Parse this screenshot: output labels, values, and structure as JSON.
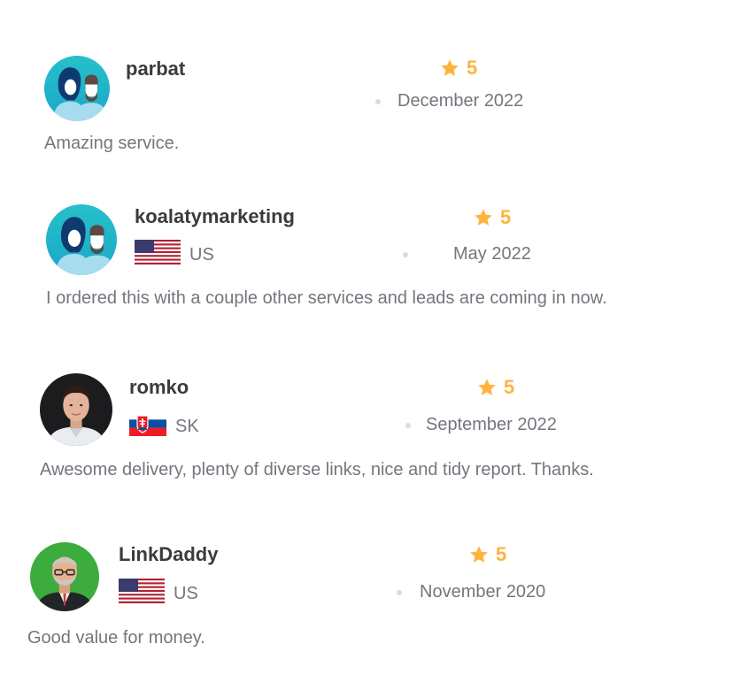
{
  "accent_colors": {
    "star": "#ffb33e",
    "username": "#3a3b3f",
    "muted_text": "#74767e"
  },
  "reviews": [
    {
      "username": "parbat",
      "country": "",
      "flag_icon": "",
      "rating": "5",
      "date": "December 2022",
      "comment": "Amazing service.",
      "avatar_icon": "generic-couple-avatar-icon"
    },
    {
      "username": "koalatymarketing",
      "country": "US",
      "flag_icon": "us-flag-icon",
      "rating": "5",
      "date": "May 2022",
      "comment": "I ordered this with a couple other services and leads are coming in now.",
      "avatar_icon": "generic-couple-avatar-icon"
    },
    {
      "username": "romko",
      "country": "SK",
      "flag_icon": "slovakia-flag-icon",
      "rating": "5",
      "date": "September 2022",
      "comment": "Awesome delivery, plenty of diverse links, nice and tidy report. Thanks.",
      "avatar_icon": "user-photo-avatar"
    },
    {
      "username": "LinkDaddy",
      "country": "US",
      "flag_icon": "us-flag-icon",
      "rating": "5",
      "date": "November 2020",
      "comment": "Good value for money.",
      "avatar_icon": "user-photo-avatar"
    }
  ]
}
